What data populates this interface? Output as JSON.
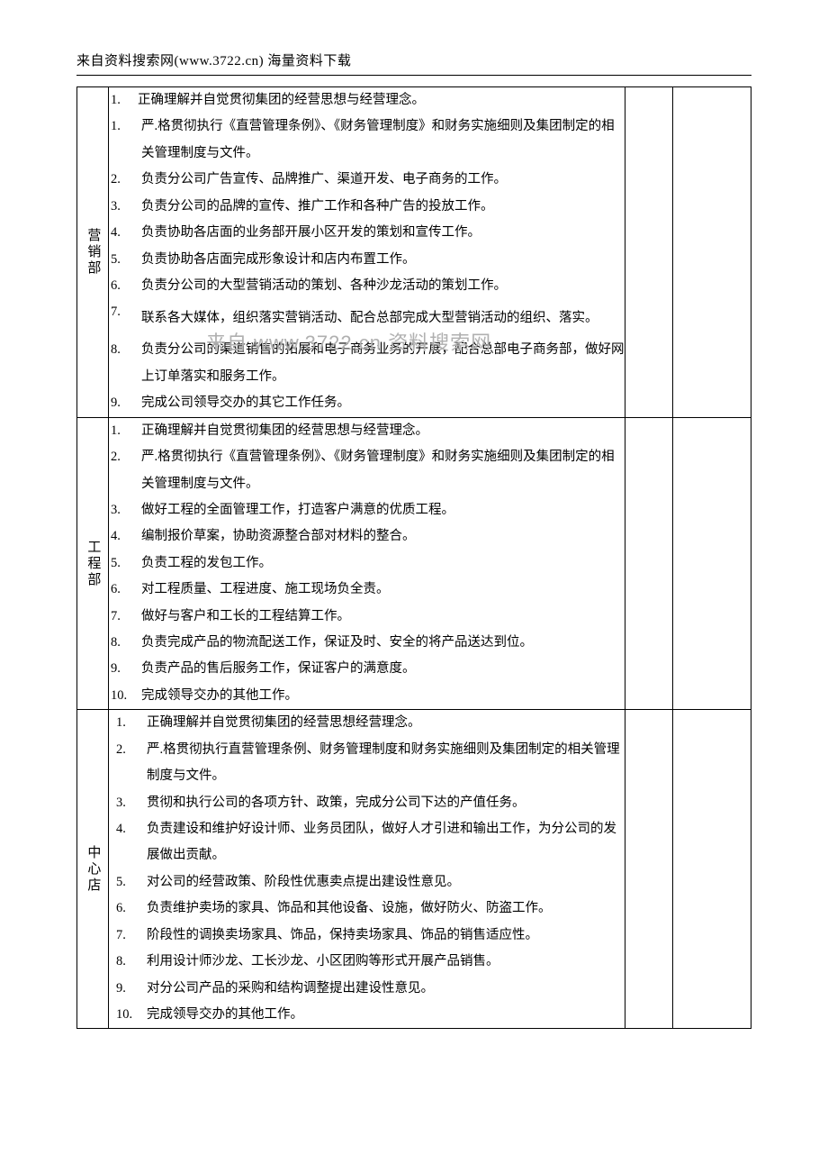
{
  "header": "来自资料搜索网(www.3722.cn)  海量资料下载",
  "watermark": "来自  www.3722.cn 资料搜索网",
  "sections": [
    {
      "label": "营销部",
      "lead_item": "正确理解并自觉贯彻集团的经营思想与经营理念。",
      "items": [
        "严.格贯彻执行《直营管理条例》、《财务管理制度》和财务实施细则及集团制定的相关管理制度与文件。",
        "负责分公司广告宣传、品牌推广、渠道开发、电子商务的工作。",
        "负责分公司的品牌的宣传、推广工作和各种广告的投放工作。",
        "负责协助各店面的业务部开展小区开发的策划和宣传工作。",
        "负责协助各店面完成形象设计和店内布置工作。",
        "负责分公司的大型营销活动的策划、各种沙龙活动的策划工作。",
        "联系各大媒体，组织落实营销活动、配合总部完成大型营销活动的组织、落实。",
        "负责分公司的渠道销售的拓展和电子商务业务的开展，配合总部电子商务部，做好网上订单落实和服务工作。",
        "完成公司领导交办的其它工作任务。"
      ]
    },
    {
      "label": "工程部",
      "items": [
        "正确理解并自觉贯彻集团的经营思想与经营理念。",
        "严.格贯彻执行《直营管理条例》、《财务管理制度》和财务实施细则及集团制定的相关管理制度与文件。",
        "做好工程的全面管理工作，打造客户满意的优质工程。",
        "编制报价草案，协助资源整合部对材料的整合。",
        "负责工程的发包工作。",
        "对工程质量、工程进度、施工现场负全责。",
        "做好与客户和工长的工程结算工作。",
        "负责完成产品的物流配送工作，保证及时、安全的将产品送达到位。",
        "负责产品的售后服务工作，保证客户的满意度。",
        "完成领导交办的其他工作。"
      ]
    },
    {
      "label": "中心店",
      "items": [
        "正确理解并自觉贯彻集团的经营思想经营理念。",
        "严.格贯彻执行直营管理条例、财务管理制度和财务实施细则及集团制定的相关管理制度与文件。",
        "贯彻和执行公司的各项方针、政策，完成分公司下达的产值任务。",
        "负责建设和维护好设计师、业务员团队，做好人才引进和输出工作，为分公司的发展做出贡献。",
        "对公司的经营政策、阶段性优惠卖点提出建设性意见。",
        "负责维护卖场的家具、饰品和其他设备、设施，做好防火、防盗工作。",
        "阶段性的调换卖场家具、饰品，保持卖场家具、饰品的销售适应性。",
        "利用设计师沙龙、工长沙龙、小区团购等形式开展产品销售。",
        "对分公司产品的采购和结构调整提出建设性意见。",
        "完成领导交办的其他工作。"
      ]
    }
  ]
}
